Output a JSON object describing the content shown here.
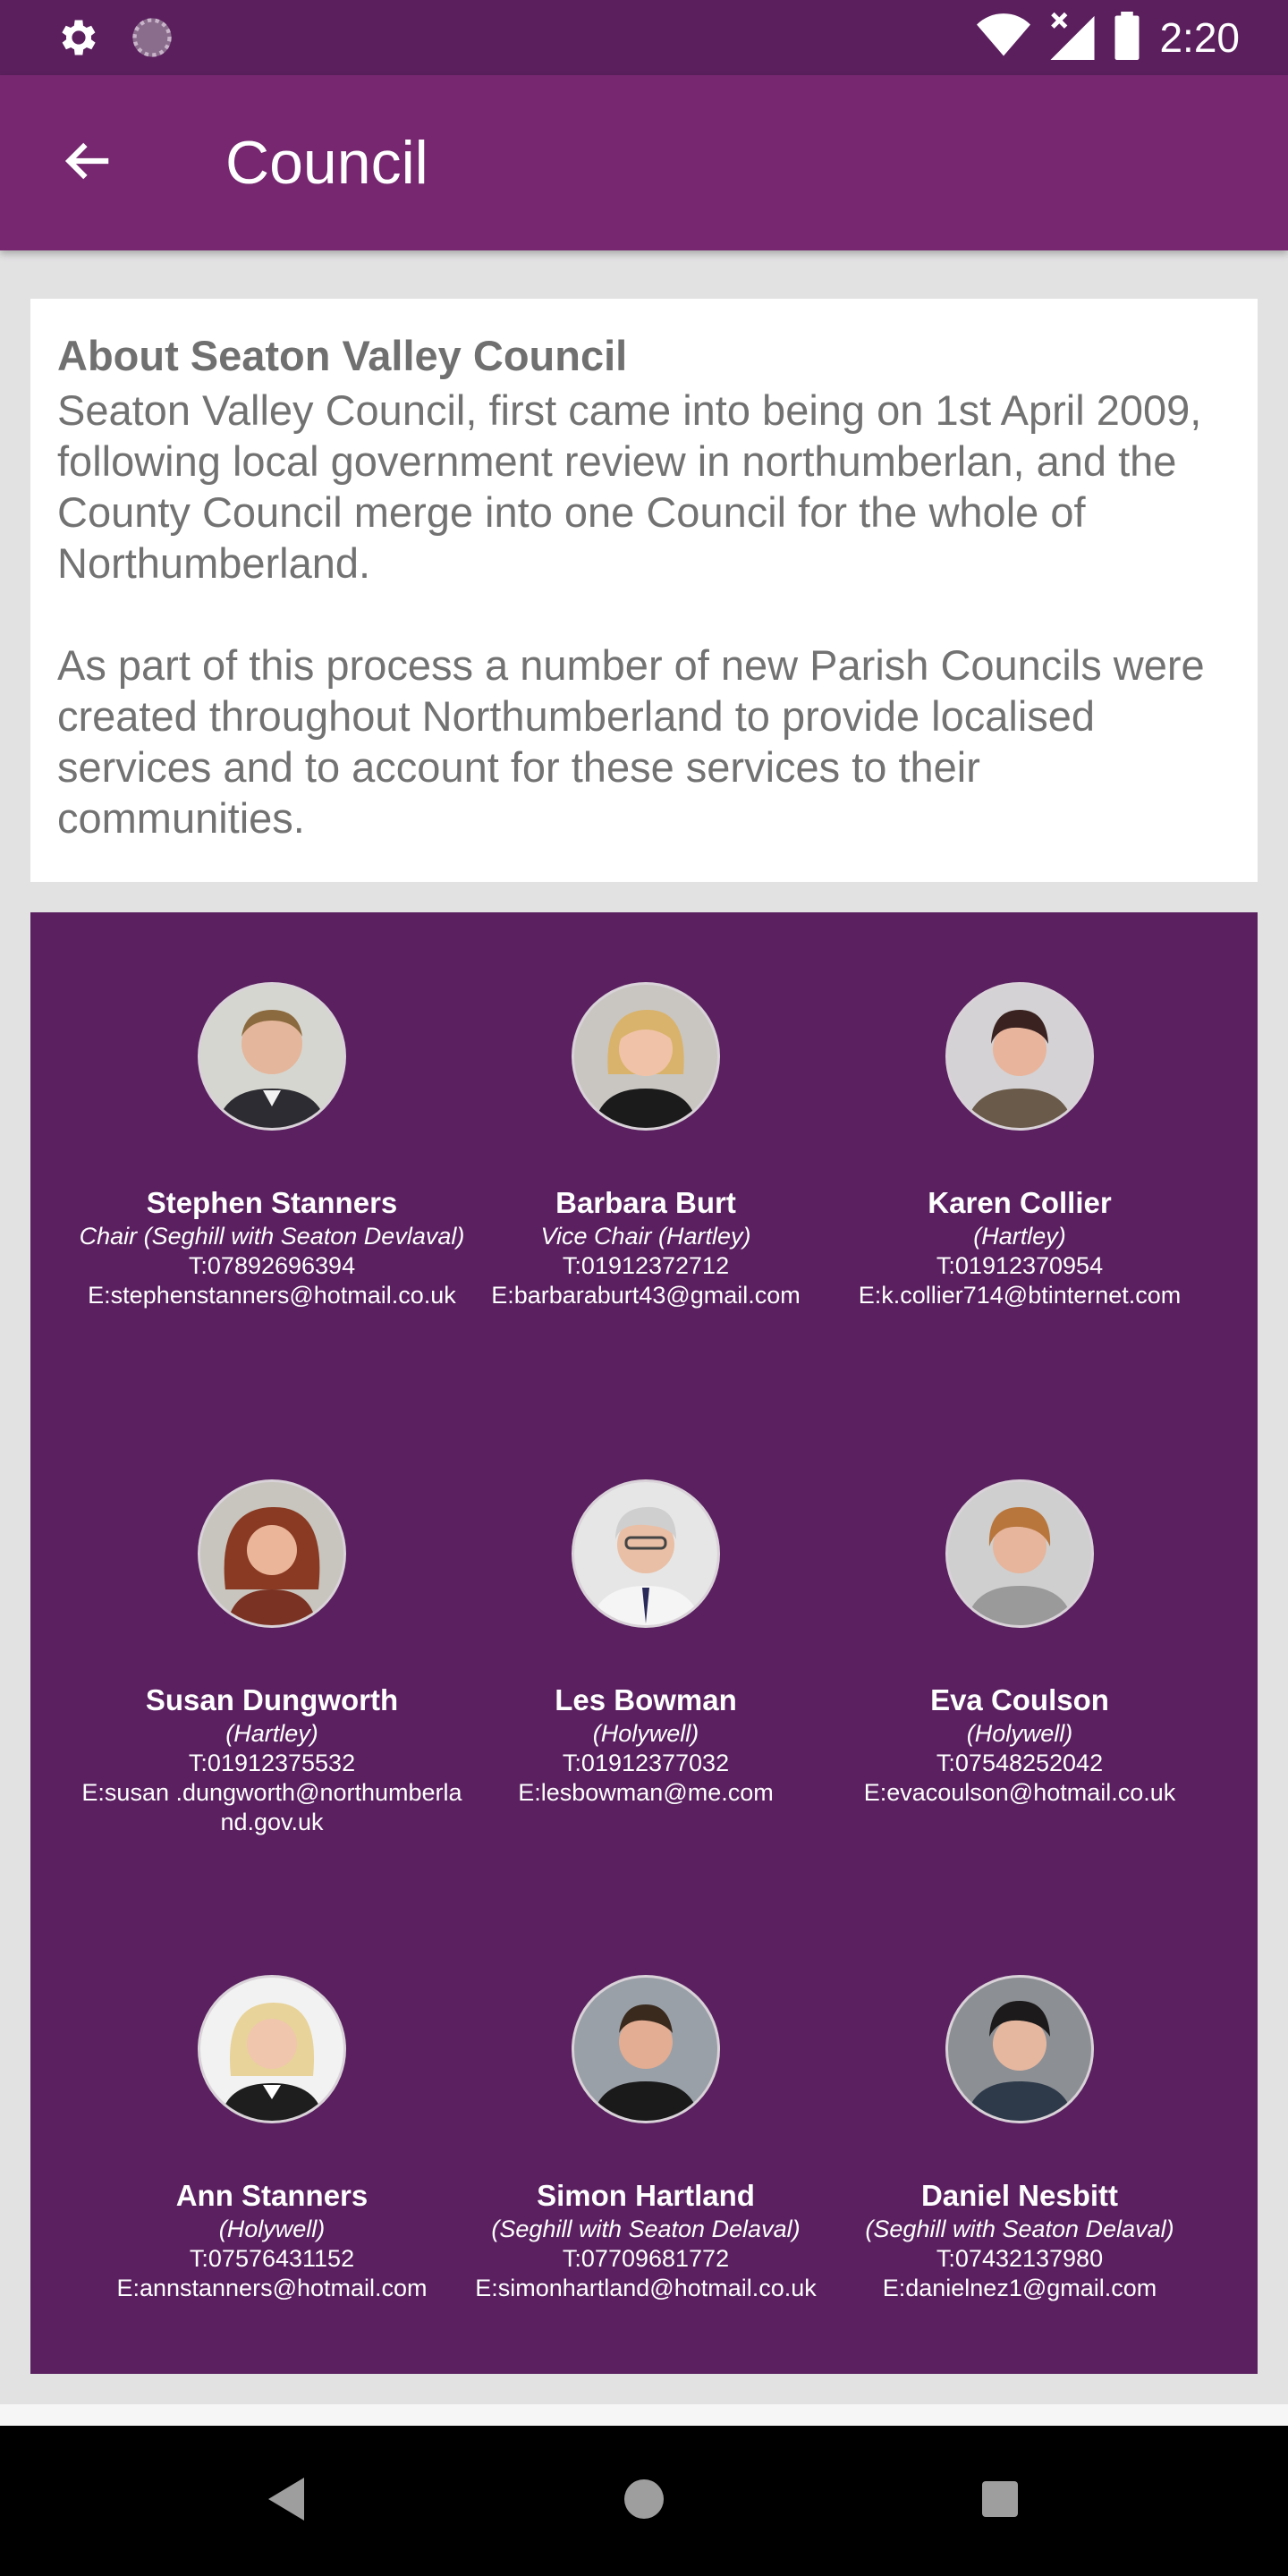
{
  "status_bar": {
    "time": "2:20"
  },
  "app_bar": {
    "title": "Council"
  },
  "about": {
    "title": "About Seaton Valley Council",
    "paragraphs": [
      "Seaton Valley Council, first came into being on 1st April 2009, following local government review in northumberlan, and the County Council merge into one Council for the whole of Northumberland.",
      "As part of this process a number of new Parish Councils were created throughout Northumberland to provide localised services and to account for these services to their communities."
    ]
  },
  "members": [
    {
      "name": "Stephen Stanners",
      "role": "Chair (Seghill with Seaton Devlaval)",
      "phone": "T:07892696394",
      "email": "E:stephenstanners@hotmail.co.uk"
    },
    {
      "name": "Barbara Burt",
      "role": "Vice Chair (Hartley)",
      "phone": "T:01912372712",
      "email": "E:barbaraburt43@gmail.com"
    },
    {
      "name": "Karen Collier",
      "role": "(Hartley)",
      "phone": "T:01912370954",
      "email": "E:k.collier714@btinternet.com"
    },
    {
      "name": "Susan Dungworth",
      "role": "(Hartley)",
      "phone": "T:01912375532",
      "email": "E:susan .dungworth@northumberland.gov.uk"
    },
    {
      "name": "Les Bowman",
      "role": "(Holywell)",
      "phone": "T:01912377032",
      "email": "E:lesbowman@me.com"
    },
    {
      "name": "Eva Coulson",
      "role": "(Holywell)",
      "phone": "T:07548252042",
      "email": "E:evacoulson@hotmail.co.uk"
    },
    {
      "name": "Ann Stanners",
      "role": "(Holywell)",
      "phone": "T:07576431152",
      "email": "E:annstanners@hotmail.com"
    },
    {
      "name": "Simon Hartland",
      "role": "(Seghill with Seaton Delaval)",
      "phone": "T:07709681772",
      "email": "E:simonhartland@hotmail.co.uk"
    },
    {
      "name": "Daniel Nesbitt",
      "role": "(Seghill with Seaton Delaval)",
      "phone": "T:07432137980",
      "email": "E:danielnez1@gmail.com"
    }
  ],
  "colors": {
    "status_bar": "#5b1f5e",
    "app_bar": "#76276f",
    "panel": "#5a2060"
  },
  "icons": {
    "settings": "gear-icon",
    "loading": "spinner-icon",
    "wifi": "wifi-icon",
    "signal": "cell-signal-icon",
    "battery": "battery-icon",
    "back": "arrow-back-icon"
  }
}
